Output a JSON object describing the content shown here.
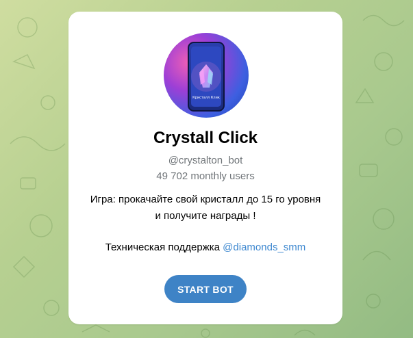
{
  "bot": {
    "name": "Crystall Click",
    "username": "@crystalton_bot",
    "monthly_users": "49 702 monthly users",
    "description_line1": "Игра: прокачайте свой кристалл до 15 го уровня",
    "description_line2": "и получите награды !",
    "support_text": "Техническая поддержка",
    "support_link": "@diamonds_smm",
    "start_button": "START BOT",
    "avatar_caption": "Кристалл Клик"
  },
  "colors": {
    "background": "#b7d091",
    "card": "#ffffff",
    "button": "#3e83c6",
    "link": "#3e88d0",
    "muted_text": "#707579"
  }
}
